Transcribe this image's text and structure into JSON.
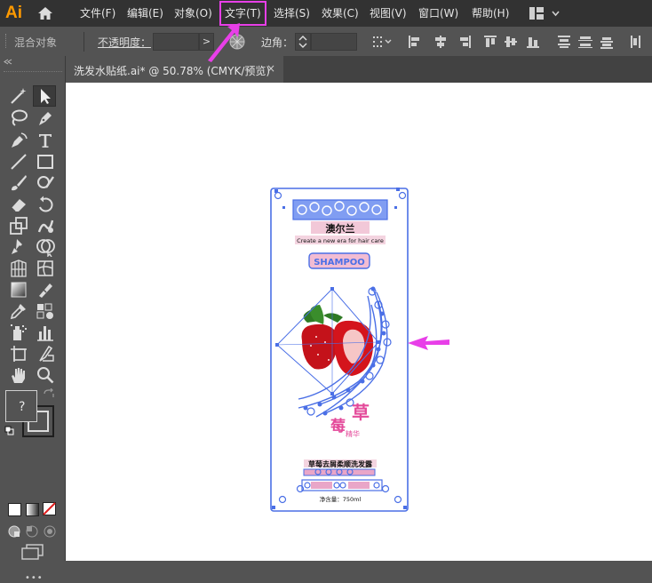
{
  "app": {
    "logo": "Ai"
  },
  "menu": {
    "file": "文件(F)",
    "edit": "编辑(E)",
    "object": "对象(O)",
    "type": "文字(T)",
    "select": "选择(S)",
    "effect": "效果(C)",
    "view": "视图(V)",
    "window": "窗口(W)",
    "help": "帮助(H)"
  },
  "control": {
    "mode": "混合对象",
    "opacity_label": "不透明度：",
    "corner_label": "边角："
  },
  "document": {
    "tab_title": "洗发水贴纸.ai* @ 50.78% (CMYK/预览)",
    "close": "×"
  },
  "artwork": {
    "brand": "澳尔兰",
    "tagline": "Create a new era for hair care",
    "badge": "SHAMPOO",
    "char1": "草",
    "char2": "莓",
    "sub": "精华",
    "product": "草莓去屑柔顺洗发露",
    "volume": "净含量：750ml"
  },
  "colors": {
    "highlight": "#e83fe8",
    "selection": "#4a6fe6",
    "accent_logo": "#ff9a00"
  },
  "toolbar": {
    "more": "•••"
  }
}
